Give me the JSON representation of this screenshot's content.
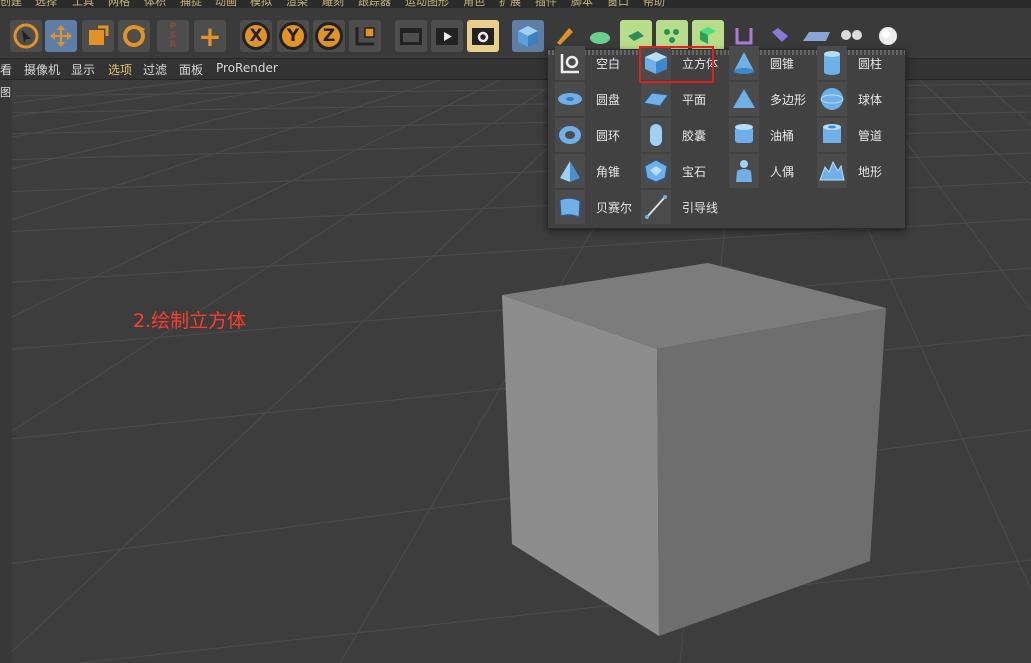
{
  "menu": {
    "items": [
      "创建",
      "选择",
      "工具",
      "网格",
      "体积",
      "捕捉",
      "动画",
      "模拟",
      "渲染",
      "雕刻",
      "跟踪器",
      "运动图形",
      "角色",
      "扩展",
      "插件",
      "脚本",
      "窗口",
      "帮助"
    ]
  },
  "toolbar": {
    "axis_x": "X",
    "axis_y": "Y",
    "axis_z": "Z",
    "tool_icons": [
      "select-arrow-icon",
      "move-icon",
      "scale-icon",
      "rotate-icon",
      "psr-icon",
      "add-icon",
      "axis-x-icon",
      "axis-y-icon",
      "axis-z-icon",
      "coordinate-system-icon",
      "render-view-icon",
      "render-picture-viewer-icon",
      "render-settings-icon",
      "cube-icon",
      "pen-icon",
      "subdivision-icon",
      "array-icon",
      "particle-icon",
      "deformer-icon",
      "field-icon",
      "scene-icon",
      "floor-icon",
      "camera-icon",
      "light-icon"
    ]
  },
  "submenu": {
    "items": [
      "看",
      "摄像机",
      "显示",
      "选项",
      "过滤",
      "面板",
      "ProRender"
    ],
    "highlighted": "选项"
  },
  "side": {
    "label": "图"
  },
  "object_panel": {
    "columns": [
      [
        {
          "label": "空白",
          "icon": "null-icon"
        },
        {
          "label": "圆盘",
          "icon": "disc-icon"
        },
        {
          "label": "圆环",
          "icon": "torus-icon"
        },
        {
          "label": "角锥",
          "icon": "pyramid-icon"
        },
        {
          "label": "贝赛尔",
          "icon": "bezier-icon"
        }
      ],
      [
        {
          "label": "立方体",
          "icon": "cube-icon"
        },
        {
          "label": "平面",
          "icon": "plane-icon"
        },
        {
          "label": "胶囊",
          "icon": "capsule-icon"
        },
        {
          "label": "宝石",
          "icon": "gem-icon"
        },
        {
          "label": "引导线",
          "icon": "guide-icon"
        }
      ],
      [
        {
          "label": "圆锥",
          "icon": "cone-icon"
        },
        {
          "label": "多边形",
          "icon": "polygon-icon"
        },
        {
          "label": "油桶",
          "icon": "oil-tank-icon"
        },
        {
          "label": "人偶",
          "icon": "figure-icon"
        }
      ],
      [
        {
          "label": "圆柱",
          "icon": "cylinder-icon"
        },
        {
          "label": "球体",
          "icon": "sphere-icon"
        },
        {
          "label": "管道",
          "icon": "tube-icon"
        },
        {
          "label": "地形",
          "icon": "landscape-icon"
        }
      ]
    ],
    "selected": "立方体"
  },
  "annotation": {
    "text": "2.绘制立方体",
    "color": "#ff3d2b"
  },
  "colors": {
    "accent_orange": "#e39326",
    "active_blue": "#5f7ea6",
    "highlight_red": "#e0201f",
    "icon_blue": "#6fb0e8"
  }
}
